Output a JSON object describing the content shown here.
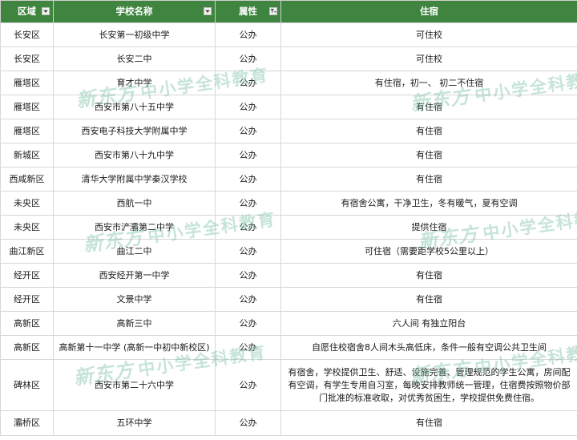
{
  "table": {
    "headers": [
      "区域",
      "学校名称",
      "属性",
      "住宿"
    ],
    "rows": [
      [
        "长安区",
        "长安第一初级中学",
        "公办",
        "可住校"
      ],
      [
        "长安区",
        "长安二中",
        "公办",
        "可住校"
      ],
      [
        "雁塔区",
        "育才中学",
        "公办",
        "有住宿，初一、 初二不住宿"
      ],
      [
        "雁塔区",
        "西安市第八十五中学",
        "公办",
        "有住宿"
      ],
      [
        "雁塔区",
        "西安电子科技大学附属中学",
        "公办",
        "有住宿"
      ],
      [
        "新城区",
        "西安市第八十九中学",
        "公办",
        "有住宿"
      ],
      [
        "西咸新区",
        "清华大学附属中学秦汉学校",
        "公办",
        "有住宿"
      ],
      [
        "未央区",
        "西航一中",
        "公办",
        "有宿舍公寓，干净卫生，冬有暖气，夏有空调"
      ],
      [
        "未央区",
        "西安市浐灞第二中学",
        "公办",
        "提供住宿"
      ],
      [
        "曲江新区",
        "曲江二中",
        "公办",
        "可住宿（需要距学校5公里以上）"
      ],
      [
        "经开区",
        "西安经开第一中学",
        "公办",
        "有住宿"
      ],
      [
        "经开区",
        "文景中学",
        "公办",
        "有住宿"
      ],
      [
        "高新区",
        "高新三中",
        "公办",
        "六人间 有独立阳台"
      ],
      [
        "高新区",
        "高新第十一中学 (高新一中初中新校区)",
        "公办",
        "自愿住校宿舍8人间木头高低床，条件一般有空调公共卫生间"
      ],
      [
        "碑林区",
        "西安市第二十六中学",
        "公办",
        "有宿舍，学校提供卫生、舒适、设施完善、管理规范的学生公寓，房间配有空调，有学生专用自习室，每晚安排教师统一管理，住宿费按照物价部门批准的标准收取，对优秀贫困生，学校提供免费住宿。"
      ],
      [
        "灞桥区",
        "五环中学",
        "公办",
        "有住宿"
      ]
    ]
  },
  "watermark": {
    "logo": "新东方",
    "subtitle": "中小学全科教育",
    "color": "#7fbfa3"
  },
  "colors": {
    "header_bg": "#3f8540",
    "header_text": "#ffffff",
    "grid_line": "#d7d7d7"
  },
  "icons": {
    "filter": "filter-dropdown-icon",
    "filter_applied": "filter-applied-icon"
  }
}
